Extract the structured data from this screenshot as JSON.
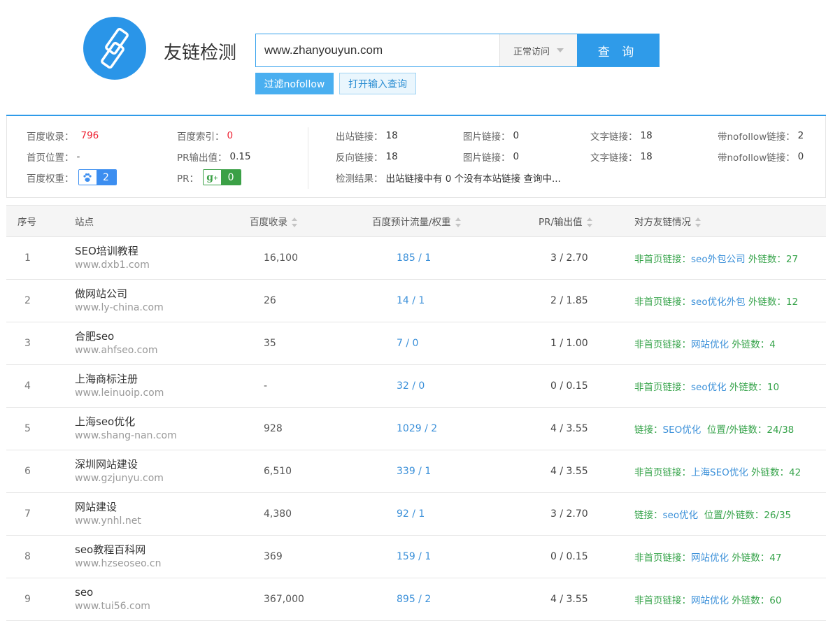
{
  "header": {
    "logo_icon": "link-chain-icon",
    "title": "友链检测",
    "search_value": "www.zhanyouyun.com",
    "mode_label": "正常访问",
    "query_button": "查 询",
    "filter_nofollow_button": "过滤nofollow",
    "open_input_button": "打开输入查询"
  },
  "stats": {
    "baidu_record_label": "百度收录：",
    "baidu_record_value": "796",
    "baidu_index_label": "百度索引：",
    "baidu_index_value": "0",
    "home_position_label": "首页位置：",
    "home_position_value": "-",
    "pr_output_label": "PR输出值：",
    "pr_output_value": "0.15",
    "baidu_weight_label": "百度权重：",
    "baidu_weight_value": "2",
    "pr_label": "PR：",
    "pr_value": "0",
    "outbound_label": "出站链接：",
    "outbound_value": "18",
    "image_link_label": "图片链接：",
    "image_link_value": "0",
    "text_link_label": "文字链接：",
    "text_link_value": "18",
    "nofollow_label": "带nofollow链接：",
    "nofollow_value": "2",
    "reverse_label": "反向链接：",
    "reverse_value": "18",
    "image_link2_label": "图片链接：",
    "image_link2_value": "0",
    "text_link2_label": "文字链接：",
    "text_link2_value": "18",
    "nofollow2_label": "带nofollow链接：",
    "nofollow2_value": "0",
    "result_label": "检测结果：",
    "result_value": "出站链接中有 0 个没有本站链接 查询中..."
  },
  "table": {
    "headers": [
      "序号",
      "站点",
      "百度收录",
      "百度预计流量/权重",
      "PR/输出值",
      "对方友链情况"
    ],
    "rows": [
      {
        "idx": "1",
        "name": "SEO培训教程",
        "url": "www.dxb1.com",
        "rec": "16,100",
        "flow": "185 / 1",
        "pr": "3 / 2.70",
        "fr_pre": "非首页链接：",
        "fr_link": "seo外包公司",
        "fr_post": " 外链数：27"
      },
      {
        "idx": "2",
        "name": "做网站公司",
        "url": "www.ly-china.com",
        "rec": "26",
        "flow": "14 / 1",
        "pr": "2 / 1.85",
        "fr_pre": "非首页链接：",
        "fr_link": "seo优化外包",
        "fr_post": " 外链数：12"
      },
      {
        "idx": "3",
        "name": "合肥seo",
        "url": "www.ahfseo.com",
        "rec": "35",
        "flow": "7 / 0",
        "pr": "1 / 1.00",
        "fr_pre": "非首页链接：",
        "fr_link": "网站优化",
        "fr_post": " 外链数：4"
      },
      {
        "idx": "4",
        "name": "上海商标注册",
        "url": "www.leinuoip.com",
        "rec": "-",
        "flow": "32 / 0",
        "pr": "0 / 0.15",
        "fr_pre": "非首页链接：",
        "fr_link": "seo优化",
        "fr_post": " 外链数：10"
      },
      {
        "idx": "5",
        "name": "上海seo优化",
        "url": "www.shang-nan.com",
        "rec": "928",
        "flow": "1029 / 2",
        "pr": "4 / 3.55",
        "fr_pre": "链接：",
        "fr_link": "SEO优化",
        "fr_post": "  位置/外链数：24/38"
      },
      {
        "idx": "6",
        "name": "深圳网站建设",
        "url": "www.gzjunyu.com",
        "rec": "6,510",
        "flow": "339 / 1",
        "pr": "4 / 3.55",
        "fr_pre": "非首页链接：",
        "fr_link": "上海SEO优化",
        "fr_post": " 外链数：42"
      },
      {
        "idx": "7",
        "name": "网站建设",
        "url": "www.ynhl.net",
        "rec": "4,380",
        "flow": "92 / 1",
        "pr": "3 / 2.70",
        "fr_pre": "链接：",
        "fr_link": "seo优化",
        "fr_post": "  位置/外链数：26/35"
      },
      {
        "idx": "8",
        "name": "seo教程百科网",
        "url": "www.hzseoseo.cn",
        "rec": "369",
        "flow": "159 / 1",
        "pr": "0 / 0.15",
        "fr_pre": "非首页链接：",
        "fr_link": "网站优化",
        "fr_post": " 外链数：47"
      },
      {
        "idx": "9",
        "name": "seo",
        "url": "www.tui56.com",
        "rec": "367,000",
        "flow": "895 / 2",
        "pr": "4 / 3.55",
        "fr_pre": "非首页链接：",
        "fr_link": "网站优化",
        "fr_post": " 外链数：60"
      }
    ]
  }
}
